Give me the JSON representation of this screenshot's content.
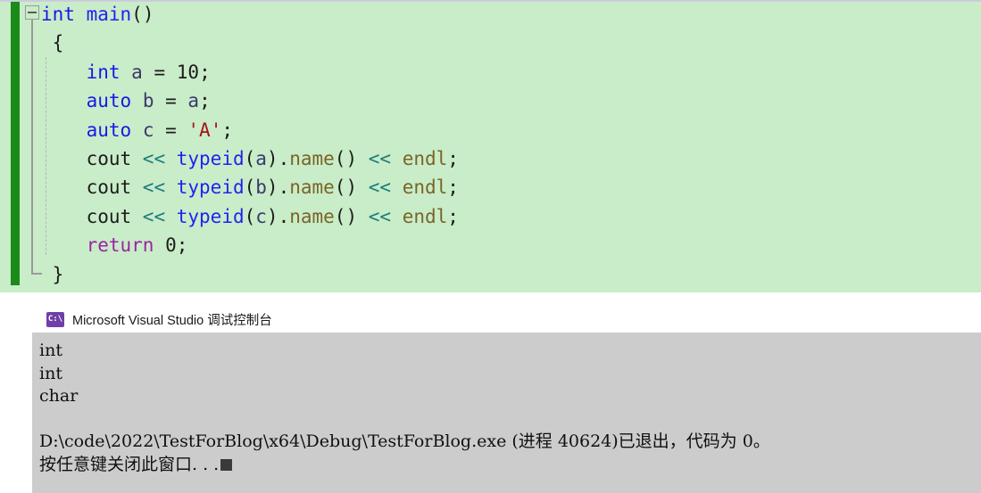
{
  "editor": {
    "name": "visual-studio-code-editor",
    "background_color": "#C9ECC9",
    "change_bar_color": "#1A8A18",
    "fold_marker": "collapse-outline",
    "code_lines": [
      {
        "indent": 0,
        "tokens": [
          {
            "t": "kw",
            "v": "int"
          },
          {
            "t": "plain",
            "v": " "
          },
          {
            "t": "fn",
            "v": "main"
          },
          {
            "t": "plain",
            "v": "()"
          }
        ]
      },
      {
        "indent": 1,
        "tokens": [
          {
            "t": "plain",
            "v": "{"
          }
        ]
      },
      {
        "indent": 2,
        "tokens": [
          {
            "t": "kw",
            "v": "int"
          },
          {
            "t": "plain",
            "v": " "
          },
          {
            "t": "id",
            "v": "a"
          },
          {
            "t": "plain",
            "v": " = "
          },
          {
            "t": "num",
            "v": "10"
          },
          {
            "t": "plain",
            "v": ";"
          }
        ]
      },
      {
        "indent": 2,
        "tokens": [
          {
            "t": "kw",
            "v": "auto"
          },
          {
            "t": "plain",
            "v": " "
          },
          {
            "t": "id",
            "v": "b"
          },
          {
            "t": "plain",
            "v": " = "
          },
          {
            "t": "id",
            "v": "a"
          },
          {
            "t": "plain",
            "v": ";"
          }
        ]
      },
      {
        "indent": 2,
        "tokens": [
          {
            "t": "kw",
            "v": "auto"
          },
          {
            "t": "plain",
            "v": " "
          },
          {
            "t": "id",
            "v": "c"
          },
          {
            "t": "plain",
            "v": " = "
          },
          {
            "t": "str",
            "v": "'A'"
          },
          {
            "t": "plain",
            "v": ";"
          }
        ]
      },
      {
        "indent": 2,
        "tokens": [
          {
            "t": "plain",
            "v": "cout "
          },
          {
            "t": "op",
            "v": "<<"
          },
          {
            "t": "plain",
            "v": " "
          },
          {
            "t": "fn",
            "v": "typeid"
          },
          {
            "t": "plain",
            "v": "("
          },
          {
            "t": "id",
            "v": "a"
          },
          {
            "t": "plain",
            "v": ")."
          },
          {
            "t": "memb",
            "v": "name"
          },
          {
            "t": "plain",
            "v": "() "
          },
          {
            "t": "op",
            "v": "<<"
          },
          {
            "t": "plain",
            "v": " "
          },
          {
            "t": "memb",
            "v": "endl"
          },
          {
            "t": "plain",
            "v": ";"
          }
        ]
      },
      {
        "indent": 2,
        "tokens": [
          {
            "t": "plain",
            "v": "cout "
          },
          {
            "t": "op",
            "v": "<<"
          },
          {
            "t": "plain",
            "v": " "
          },
          {
            "t": "fn",
            "v": "typeid"
          },
          {
            "t": "plain",
            "v": "("
          },
          {
            "t": "id",
            "v": "b"
          },
          {
            "t": "plain",
            "v": ")."
          },
          {
            "t": "memb",
            "v": "name"
          },
          {
            "t": "plain",
            "v": "() "
          },
          {
            "t": "op",
            "v": "<<"
          },
          {
            "t": "plain",
            "v": " "
          },
          {
            "t": "memb",
            "v": "endl"
          },
          {
            "t": "plain",
            "v": ";"
          }
        ]
      },
      {
        "indent": 2,
        "tokens": [
          {
            "t": "plain",
            "v": "cout "
          },
          {
            "t": "op",
            "v": "<<"
          },
          {
            "t": "plain",
            "v": " "
          },
          {
            "t": "fn",
            "v": "typeid"
          },
          {
            "t": "plain",
            "v": "("
          },
          {
            "t": "id",
            "v": "c"
          },
          {
            "t": "plain",
            "v": ")."
          },
          {
            "t": "memb",
            "v": "name"
          },
          {
            "t": "plain",
            "v": "() "
          },
          {
            "t": "op",
            "v": "<<"
          },
          {
            "t": "plain",
            "v": " "
          },
          {
            "t": "memb",
            "v": "endl"
          },
          {
            "t": "plain",
            "v": ";"
          }
        ]
      },
      {
        "indent": 2,
        "tokens": [
          {
            "t": "ctl",
            "v": "return"
          },
          {
            "t": "plain",
            "v": " "
          },
          {
            "t": "num",
            "v": "0"
          },
          {
            "t": "plain",
            "v": ";"
          }
        ]
      },
      {
        "indent": 1,
        "tokens": [
          {
            "t": "plain",
            "v": "}"
          }
        ]
      }
    ]
  },
  "console": {
    "icon_name": "command-prompt-icon",
    "icon_glyph": "C:\\",
    "title": "Microsoft Visual Studio 调试控制台",
    "background_color": "#CCCCCC",
    "titlebar_color": "#FFFFFF",
    "output_lines": [
      "int",
      "int",
      "char",
      "",
      "D:\\code\\2022\\TestForBlog\\x64\\Debug\\TestForBlog.exe (进程 40624)已退出，代码为 0。"
    ],
    "prompt_line": "按任意键关闭此窗口. . .",
    "cursor": "block"
  }
}
